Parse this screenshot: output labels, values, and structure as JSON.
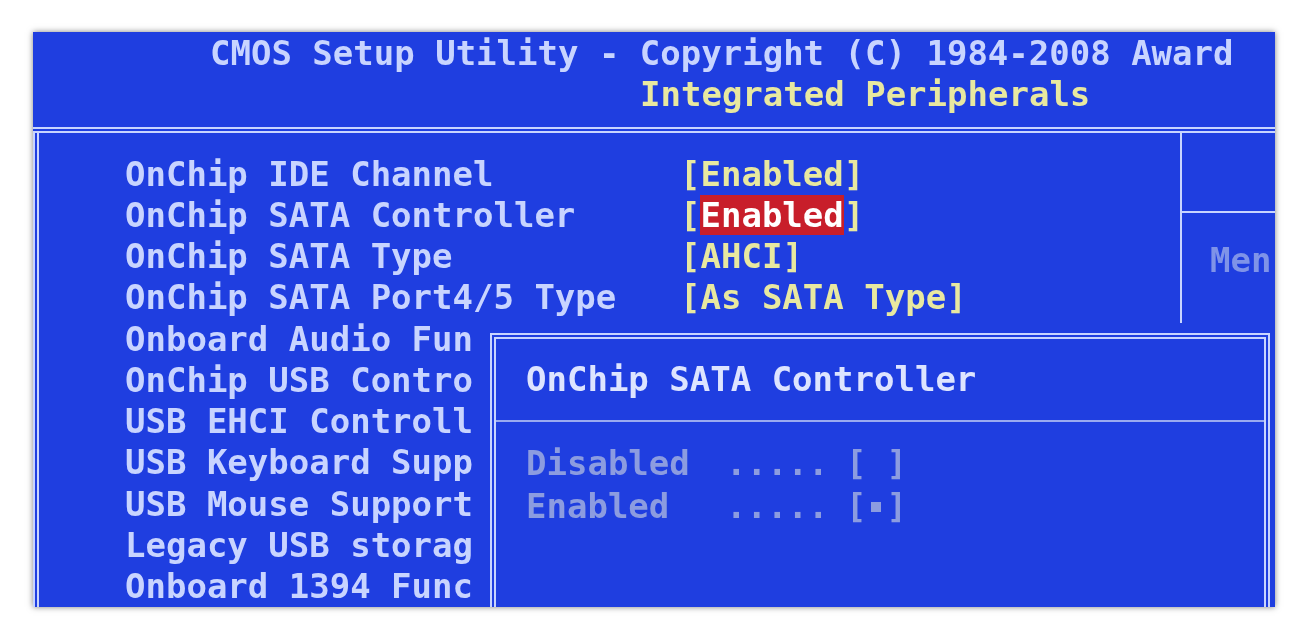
{
  "header": {
    "title": "CMOS Setup Utility - Copyright (C) 1984-2008 Award",
    "subtitle": "Integrated Peripherals"
  },
  "items": [
    {
      "label": "OnChip IDE Channel",
      "open": "[",
      "value": "Enabled",
      "close": "]",
      "selected": false
    },
    {
      "label": "OnChip SATA Controller",
      "open": "[",
      "value": "Enabled",
      "close": "]",
      "selected": true
    },
    {
      "label": "OnChip SATA Type",
      "open": "[",
      "value": "AHCI",
      "close": "]",
      "selected": false
    },
    {
      "label": "OnChip SATA Port4/5 Type",
      "open": "[",
      "value": "As SATA Type",
      "close": "]",
      "selected": false
    },
    {
      "label": "Onboard Audio Fun"
    },
    {
      "label": "OnChip USB Contro"
    },
    {
      "label": "USB EHCI Controll"
    },
    {
      "label": "USB Keyboard Supp"
    },
    {
      "label": "USB Mouse Support"
    },
    {
      "label": "Legacy USB storag"
    },
    {
      "label": "Onboard 1394 Func"
    }
  ],
  "help_panel": {
    "text": "Men"
  },
  "dialog": {
    "title": "OnChip SATA Controller",
    "options": [
      {
        "label": "Disabled",
        "leader": ".....",
        "open": "[",
        "close": "]",
        "selected": false
      },
      {
        "label": "Enabled",
        "leader": ".....",
        "open": "[",
        "close": "]",
        "selected": true
      }
    ]
  }
}
